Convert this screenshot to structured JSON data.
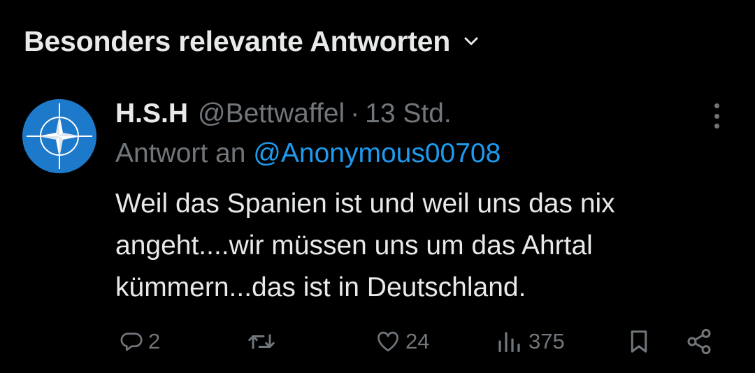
{
  "header": {
    "sort_label": "Besonders relevante Antworten",
    "sort_icon": "chevron-down-icon"
  },
  "tweet": {
    "avatar_icon": "nato-compass-star-icon",
    "display_name": "H.S.H",
    "handle": "@Bettwaffel",
    "separator": "·",
    "time": "13 Std.",
    "reply_prefix": "Antwort an",
    "reply_to": "@Anonymous00708",
    "text_lines": [
      "Weil das Spanien ist und weil uns das nix",
      "angeht....wir müssen uns um das Ahrtal",
      "kümmern...das ist in Deutschland."
    ],
    "actions": {
      "replies": "2",
      "retweets": "",
      "likes": "24",
      "views": "375"
    }
  },
  "colors": {
    "background": "#000000",
    "primary_text": "#e7e9ea",
    "secondary_text": "#71767b",
    "link": "#1d9bf0",
    "avatar_bg": "#1d79c9"
  }
}
